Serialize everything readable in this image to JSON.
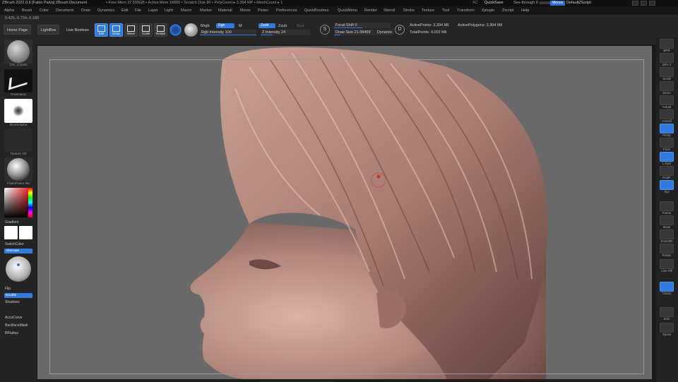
{
  "titlebar": {
    "title": "ZBrush 2022.0.8 [Fabio Paiva]   ZBrush Document",
    "stats": "▪ Free Mem 37.535GB ▪ Active Mem 16889 ▪ Scratch Disk 80 ▪ PolyCount ▸ 3.394 MP ▪ MeshCount ▸ 1",
    "ac_label": "AC",
    "quicksave": "QuickSave",
    "see_through": "See-through   0",
    "menus": "Menus",
    "default_script": "DefaultZScript"
  },
  "menubar": [
    "Alpha",
    "Brush",
    "Color",
    "Document",
    "Draw",
    "Dynamics",
    "Edit",
    "File",
    "Layer",
    "Light",
    "Macro",
    "Marker",
    "Material",
    "Movie",
    "Picker",
    "Preferences",
    "QuickBrushes",
    "QuickMenu",
    "Render",
    "Stencil",
    "Stroke",
    "Texture",
    "Tool",
    "Transform",
    "Zplugin",
    "Zscript",
    "Help"
  ],
  "toolbar": {
    "coords": "0.425,-0.734,-0.188",
    "home_page": "Home Page",
    "lightbox": "LightBox",
    "live_boolean": "Live Boolean",
    "edit": "Edit",
    "draw": "Draw",
    "move": "Move",
    "scale": "Scale",
    "rotate": "Rotate",
    "mrgb": "Mrgb",
    "rgb": "Rgb",
    "m": "M",
    "rgb_intensity": "Rgb Intensity 100",
    "zadd": "Zadd",
    "zsub": "Zsub",
    "zcut": "Zcut",
    "z_intensity": "Z Intensity 24",
    "focal_shift": "Focal Shift 0",
    "draw_size": "Draw Size 21.08459",
    "dynamic": "Dynamic",
    "active_points": "ActivePoints: 3.394 Mil",
    "active_polygons": "ActivePolygons: 3.394 Mil",
    "total_points": "TotalPoints: 4.002 Mil",
    "s_letter": "S",
    "d_letter": "D"
  },
  "left": {
    "brush": "Orb_Cracks",
    "stroke": "FreeHand",
    "alpha": "BrushAlpha",
    "texture": "Texture Off",
    "material": "FabioPaiva Ski",
    "gradient": "Gradient",
    "switch_color": "SwitchColor",
    "alternate": "Alternate",
    "flip": "Flip",
    "double": "Double",
    "shadows": "Shadows",
    "accucurve": "AccuCurve",
    "backface_mask": "BackfaceMask",
    "bradius": "BRadius"
  },
  "right": [
    "BPR",
    "SPix 3",
    "Scroll",
    "Zoom",
    "Actual",
    "AAHalf",
    "Persp",
    "Floor",
    "L.Sym",
    "PolyF",
    "Xyz",
    "Frame",
    "Move",
    "Zoom3D",
    "Rotate",
    "Line Fill",
    "Transp",
    "Solo",
    "Xpose"
  ],
  "colors": {
    "accent": "#2f7ce0",
    "viewport_bg": "#6a6a6a",
    "clay": "#b68a7d"
  }
}
